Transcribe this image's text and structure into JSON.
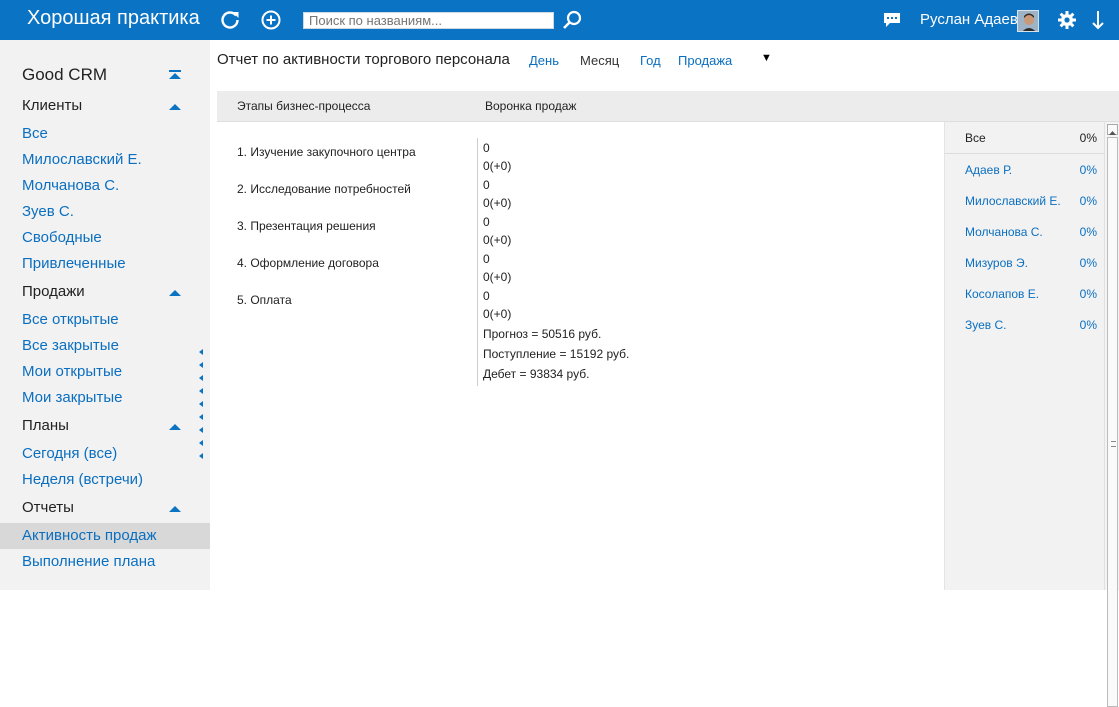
{
  "app": {
    "brand": "Хорошая практика",
    "search_placeholder": "Поиск по названиям...",
    "user_name": "Руслан Адаев",
    "accent_color": "#0b73c3"
  },
  "sidebar": {
    "title": "Good CRM",
    "sections": {
      "clients": {
        "label": "Клиенты",
        "items": [
          "Все",
          "Милославский Е.",
          "Молчанова С.",
          "Зуев С.",
          "Свободные",
          "Привлеченные"
        ]
      },
      "sales": {
        "label": "Продажи",
        "items": [
          "Все открытые",
          "Все закрытые",
          "Мои открытые",
          "Мои закрытые"
        ]
      },
      "plans": {
        "label": "Планы",
        "items": [
          "Сегодня (все)",
          "Неделя (встречи)"
        ]
      },
      "reports": {
        "label": "Отчеты",
        "items": [
          "Активность продаж",
          "Выполнение плана"
        ]
      }
    }
  },
  "report": {
    "title": "Отчет по активности торгового персонала",
    "filters": {
      "day": "День",
      "month": "Месяц",
      "year": "Год",
      "type": "Продажа"
    },
    "selected_filter": "Месяц",
    "col_stages": "Этапы бизнес-процесса",
    "col_funnel": "Воронка продаж",
    "stages": [
      {
        "label": "1.  Изучение закупочного центра",
        "count": "0",
        "delta": "0(+0)"
      },
      {
        "label": "2.  Исследование потребностей",
        "count": "0",
        "delta": "0(+0)"
      },
      {
        "label": "3.  Презентация решения",
        "count": "0",
        "delta": "0(+0)"
      },
      {
        "label": "4.  Оформление договора",
        "count": "0",
        "delta": "0(+0)"
      },
      {
        "label": "5.  Оплата",
        "count": "0",
        "delta": "0(+0)"
      }
    ],
    "forecast": "Прогноз = 50516 руб.",
    "income": "Поступление = 15192 руб.",
    "debit": "Дебет = 93834 руб."
  },
  "panel": {
    "all_label": "Все",
    "all_pct": "0%",
    "people": [
      {
        "name": "Адаев Р.",
        "pct": "0%"
      },
      {
        "name": "Милославский Е.",
        "pct": "0%"
      },
      {
        "name": "Молчанова С.",
        "pct": "0%"
      },
      {
        "name": "Мизуров Э.",
        "pct": "0%"
      },
      {
        "name": "Косолапов Е.",
        "pct": "0%"
      },
      {
        "name": "Зуев С.",
        "pct": "0%"
      }
    ]
  }
}
